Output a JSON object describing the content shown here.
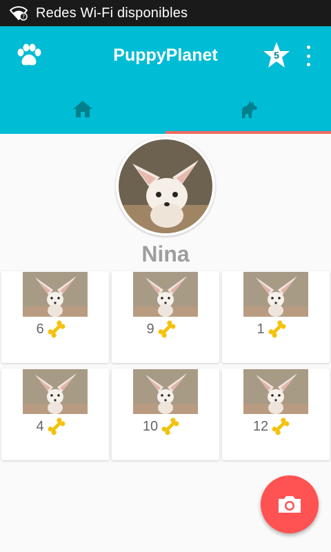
{
  "status_bar": {
    "text": "Redes Wi-Fi disponibles",
    "icon": "wifi-icon"
  },
  "toolbar": {
    "title": "PuppyPlanet",
    "left_icon": "paw-icon",
    "star_count": "5",
    "overflow_icon": "more-vert-icon"
  },
  "tabs": [
    {
      "icon": "home-icon",
      "selected": false
    },
    {
      "icon": "dog-icon",
      "selected": true
    }
  ],
  "profile": {
    "name": "Nina"
  },
  "photos": [
    {
      "likes": "6"
    },
    {
      "likes": "9"
    },
    {
      "likes": "1"
    },
    {
      "likes": "4"
    },
    {
      "likes": "10"
    },
    {
      "likes": "12"
    }
  ],
  "fab": {
    "icon": "camera-icon"
  },
  "colors": {
    "primary": "#00bcd4",
    "accent": "#ff5252",
    "tab_indicator": "#ef6a5f",
    "bone": "#f4c20d"
  }
}
